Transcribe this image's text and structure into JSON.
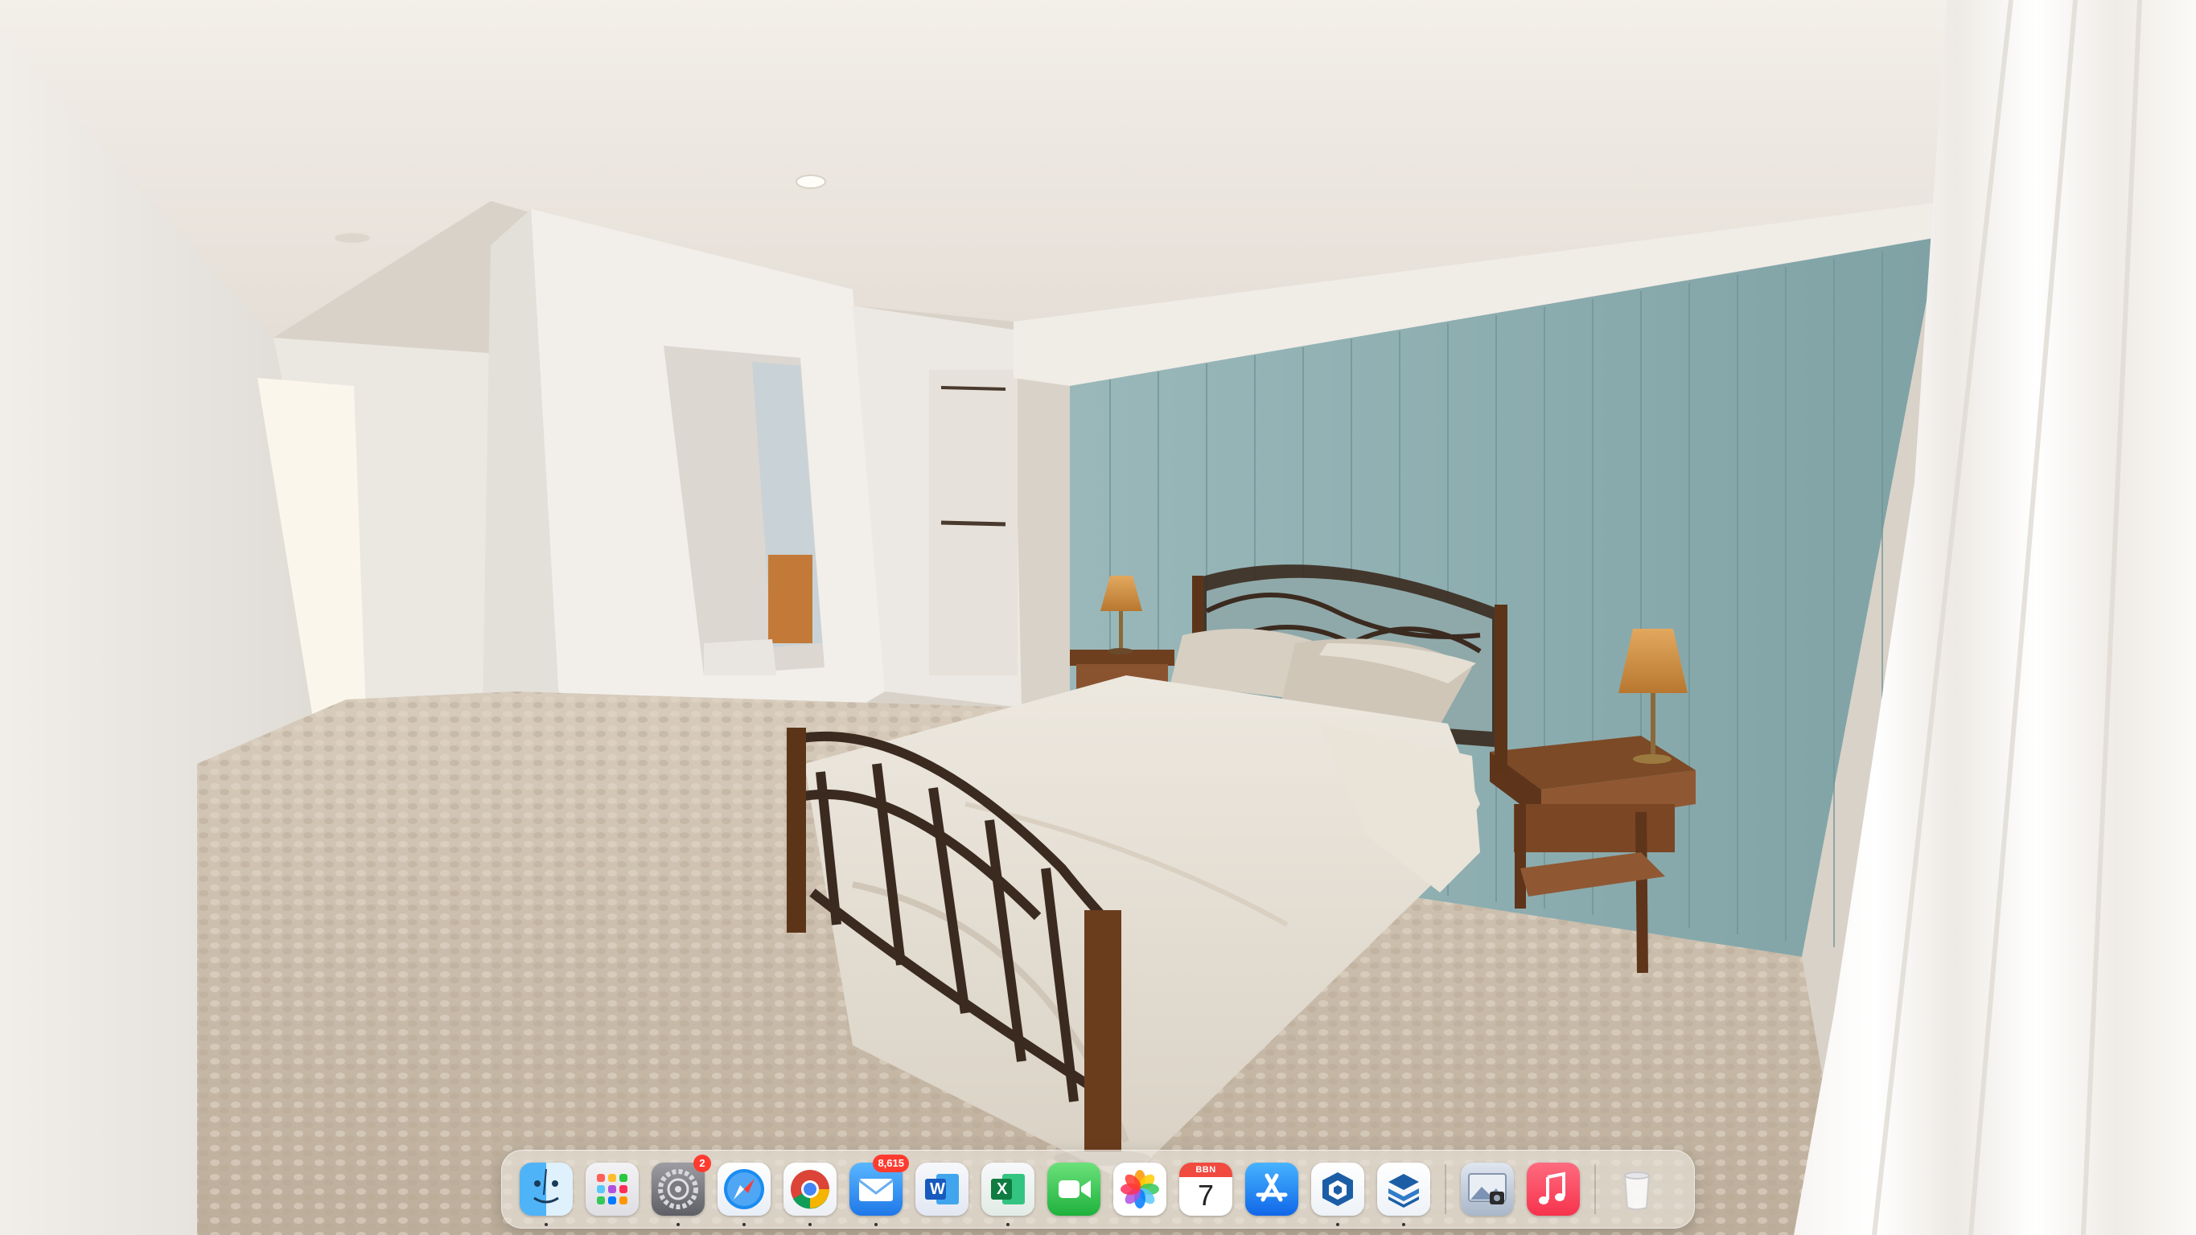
{
  "desktop": {
    "wallpaper": "bedroom-interior-render",
    "colors": {
      "accent_wall": "#8fb0b2",
      "ceiling": "#ece7e0",
      "carpet": "#cbbfae",
      "wood": "#7a4a25"
    }
  },
  "dock": {
    "items": [
      {
        "name": "Finder",
        "icon": "finder-icon",
        "running": true
      },
      {
        "name": "Launchpad",
        "icon": "launchpad-icon",
        "running": false
      },
      {
        "name": "System Settings",
        "icon": "settings-icon",
        "running": true,
        "badge": "2"
      },
      {
        "name": "Safari",
        "icon": "safari-icon",
        "running": true
      },
      {
        "name": "Google Chrome",
        "icon": "chrome-icon",
        "running": true
      },
      {
        "name": "Mail",
        "icon": "mail-icon",
        "running": true,
        "badge": "8,615"
      },
      {
        "name": "Microsoft Word",
        "icon": "word-icon",
        "running": false
      },
      {
        "name": "Microsoft Excel",
        "icon": "excel-icon",
        "running": true
      },
      {
        "name": "FaceTime",
        "icon": "facetime-icon",
        "running": false
      },
      {
        "name": "Photos",
        "icon": "photos-icon",
        "running": false
      },
      {
        "name": "Calendar",
        "icon": "calendar-icon",
        "running": false,
        "month": "BBN",
        "day": "7"
      },
      {
        "name": "App Store",
        "icon": "appstore-icon",
        "running": false
      },
      {
        "name": "SketchUp",
        "icon": "sketchup-icon",
        "running": true
      },
      {
        "name": "Layout",
        "icon": "layout-icon",
        "running": true
      },
      {
        "name": "Preview",
        "icon": "preview-icon",
        "running": false
      },
      {
        "name": "Music",
        "icon": "music-icon",
        "running": false
      },
      {
        "name": "Trash",
        "icon": "trash-icon",
        "running": false
      }
    ],
    "labels": {
      "word_glyph": "W",
      "excel_glyph": "X"
    }
  }
}
